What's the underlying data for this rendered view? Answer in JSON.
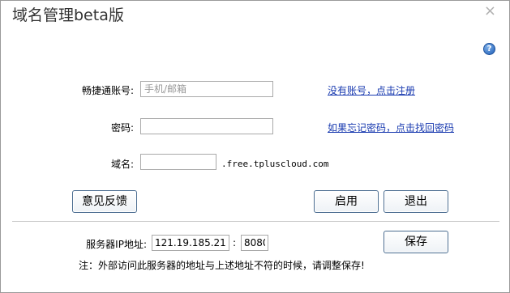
{
  "window": {
    "title": "域名管理beta版",
    "close_glyph": "×",
    "help_glyph": "?"
  },
  "form": {
    "account_label": "畅捷通账号:",
    "account_placeholder": "手机/邮箱",
    "account_value": "",
    "register_link": "没有账号，点击注册",
    "password_label": "密码:",
    "password_value": "",
    "forgot_link": "如果忘记密码，点击找回密码",
    "domain_label": "域名:",
    "domain_value": "",
    "domain_suffix": ".free.tpluscloud.com"
  },
  "buttons": {
    "feedback": "意见反馈",
    "enable": "启用",
    "exit": "退出",
    "save": "保存"
  },
  "server": {
    "label": "服务器IP地址:",
    "ip": "121.19.185.21",
    "separator": ":",
    "port": "8080",
    "note": "注：外部访问此服务器的地址与上述地址不符的时候，请调整保存!"
  },
  "colors": {
    "link": "#1a3bb0",
    "button_border": "#4a6c90",
    "help_icon": "#1f5fb8"
  }
}
